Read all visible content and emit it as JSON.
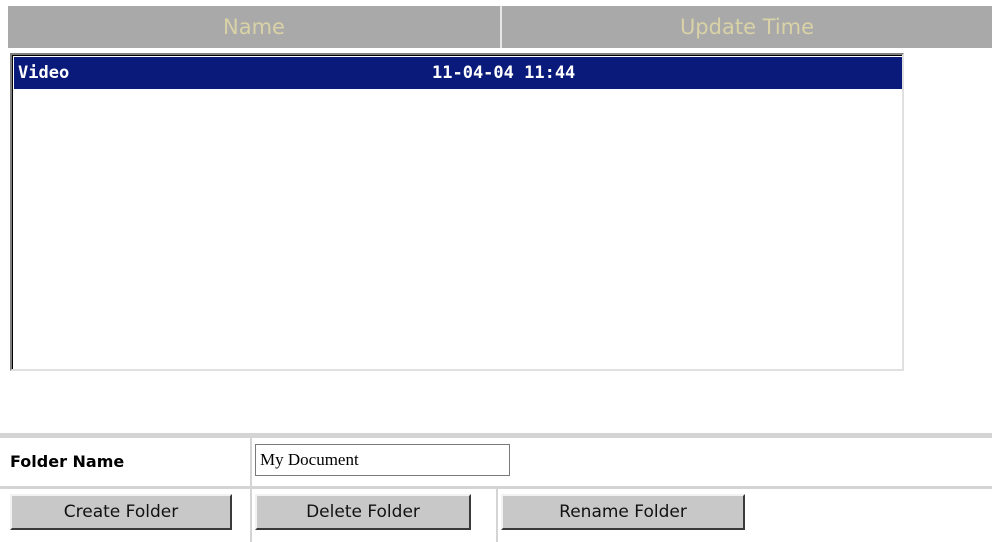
{
  "table": {
    "columns": {
      "name": "Name",
      "update_time": "Update Time"
    },
    "rows": [
      {
        "name": "Video",
        "update_time": "11-04-04 11:44",
        "selected": true
      }
    ]
  },
  "form": {
    "folder_name_label": "Folder Name",
    "folder_name_value": "My Document"
  },
  "buttons": {
    "create": "Create Folder",
    "delete": "Delete Folder",
    "rename": "Rename Folder"
  },
  "colors": {
    "header_bg": "#a9a9a9",
    "header_text": "#d9d2a6",
    "selection_bg": "#0a1a7a",
    "button_bg": "#c8c8c8"
  }
}
